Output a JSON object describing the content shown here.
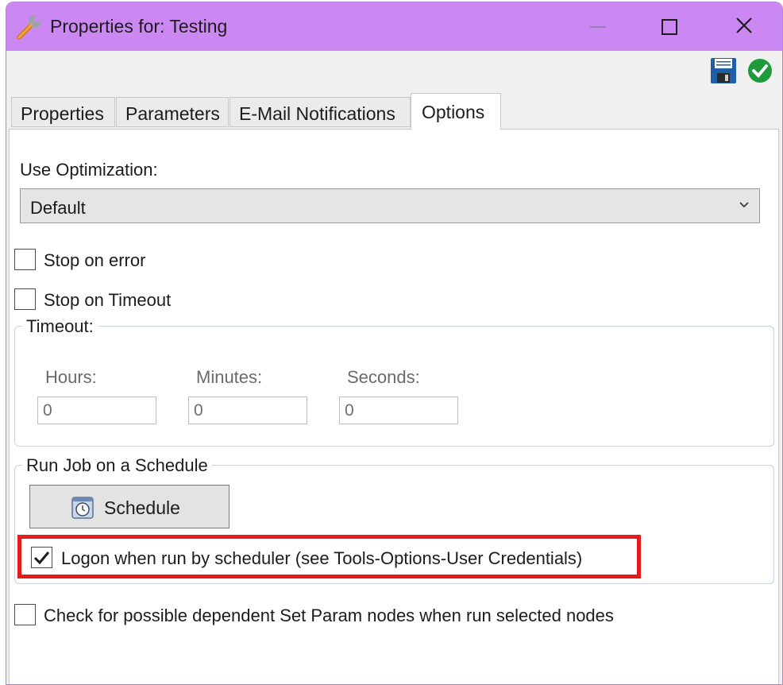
{
  "window": {
    "title": "Properties for: Testing",
    "title_icon": "wrench-icon",
    "accent_color": "#cc88f2",
    "controls": [
      "minimize-icon",
      "maximize-icon",
      "close-icon"
    ]
  },
  "toolbar": {
    "icons": [
      "save-floppy-icon",
      "checkmark-ok-icon"
    ]
  },
  "tabs": [
    {
      "label": "Properties",
      "active": false
    },
    {
      "label": "Parameters",
      "active": false
    },
    {
      "label": "E-Mail Notifications",
      "active": false
    },
    {
      "label": "Options",
      "active": true
    }
  ],
  "options": {
    "optimization_label": "Use Optimization:",
    "optimization_value": "Default",
    "stop_on_error": {
      "label": "Stop on error",
      "checked": false
    },
    "stop_on_timeout": {
      "label": "Stop on Timeout",
      "checked": false
    },
    "timeout": {
      "title": "Timeout:",
      "hours_label": "Hours:",
      "hours_value": "0",
      "minutes_label": "Minutes:",
      "minutes_value": "0",
      "seconds_label": "Seconds:",
      "seconds_value": "0"
    },
    "schedule": {
      "title": "Run Job on a Schedule",
      "button_label": "Schedule",
      "button_icon": "clock-icon",
      "logon": {
        "label": "Logon when run by scheduler (see Tools-Options-User Credentials)",
        "checked": true
      }
    },
    "check_dependent": {
      "label": "Check for possible dependent Set Param nodes when run selected nodes",
      "checked": false
    }
  },
  "highlight_color": "#e41c1c"
}
